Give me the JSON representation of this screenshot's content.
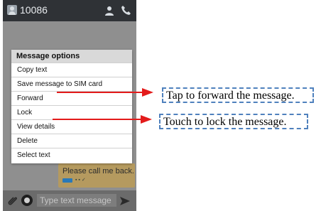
{
  "header": {
    "contact": "10086"
  },
  "dialog": {
    "title": "Message options",
    "options": [
      {
        "label": "Copy text"
      },
      {
        "label": "Save message to SIM card"
      },
      {
        "label": "Forward"
      },
      {
        "label": "Lock"
      },
      {
        "label": "View details"
      },
      {
        "label": "Delete"
      },
      {
        "label": "Select text"
      }
    ]
  },
  "bubble": {
    "text": "Please call me back."
  },
  "composer": {
    "placeholder": "Type text message"
  },
  "callouts": {
    "forward": "Tap to forward the message.",
    "lock": "Touch to lock the message."
  },
  "colors": {
    "arrow": "#e31b1b",
    "callout_border": "#4f81bd",
    "status_bar": "#2f3236"
  }
}
